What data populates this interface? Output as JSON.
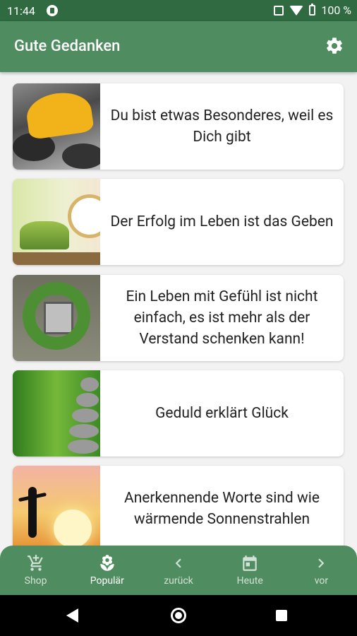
{
  "status": {
    "time": "11:44",
    "battery": "100 %"
  },
  "app": {
    "title": "Gute Gedanken"
  },
  "cards": [
    {
      "quote": "Du bist etwas Besonderes, weil es Dich gibt",
      "image": "umbrellas"
    },
    {
      "quote": "Der Erfolg im Leben ist das Geben",
      "image": "clock-plants"
    },
    {
      "quote": "Ein Leben mit Gefühl ist nicht einfach, es ist mehr als der Verstand schenken kann!",
      "image": "ivy-window"
    },
    {
      "quote": "Geduld erklärt Glück",
      "image": "bamboo-stones"
    },
    {
      "quote": "Anerkennende Worte sind wie wärmende Sonnenstrahlen",
      "image": "sunset-person"
    }
  ],
  "nav": {
    "items": [
      {
        "label": "Shop",
        "icon": "cart-plus-icon"
      },
      {
        "label": "Populär",
        "icon": "flower-icon"
      },
      {
        "label": "zurück",
        "icon": "chevron-left-icon"
      },
      {
        "label": "Heute",
        "icon": "calendar-icon"
      },
      {
        "label": "vor",
        "icon": "chevron-right-icon"
      }
    ],
    "active_index": 1
  },
  "colors": {
    "status_bar": "#2f6a41",
    "app_bar": "#4f8c5f",
    "background": "#f2f2f2",
    "card": "#ffffff"
  }
}
